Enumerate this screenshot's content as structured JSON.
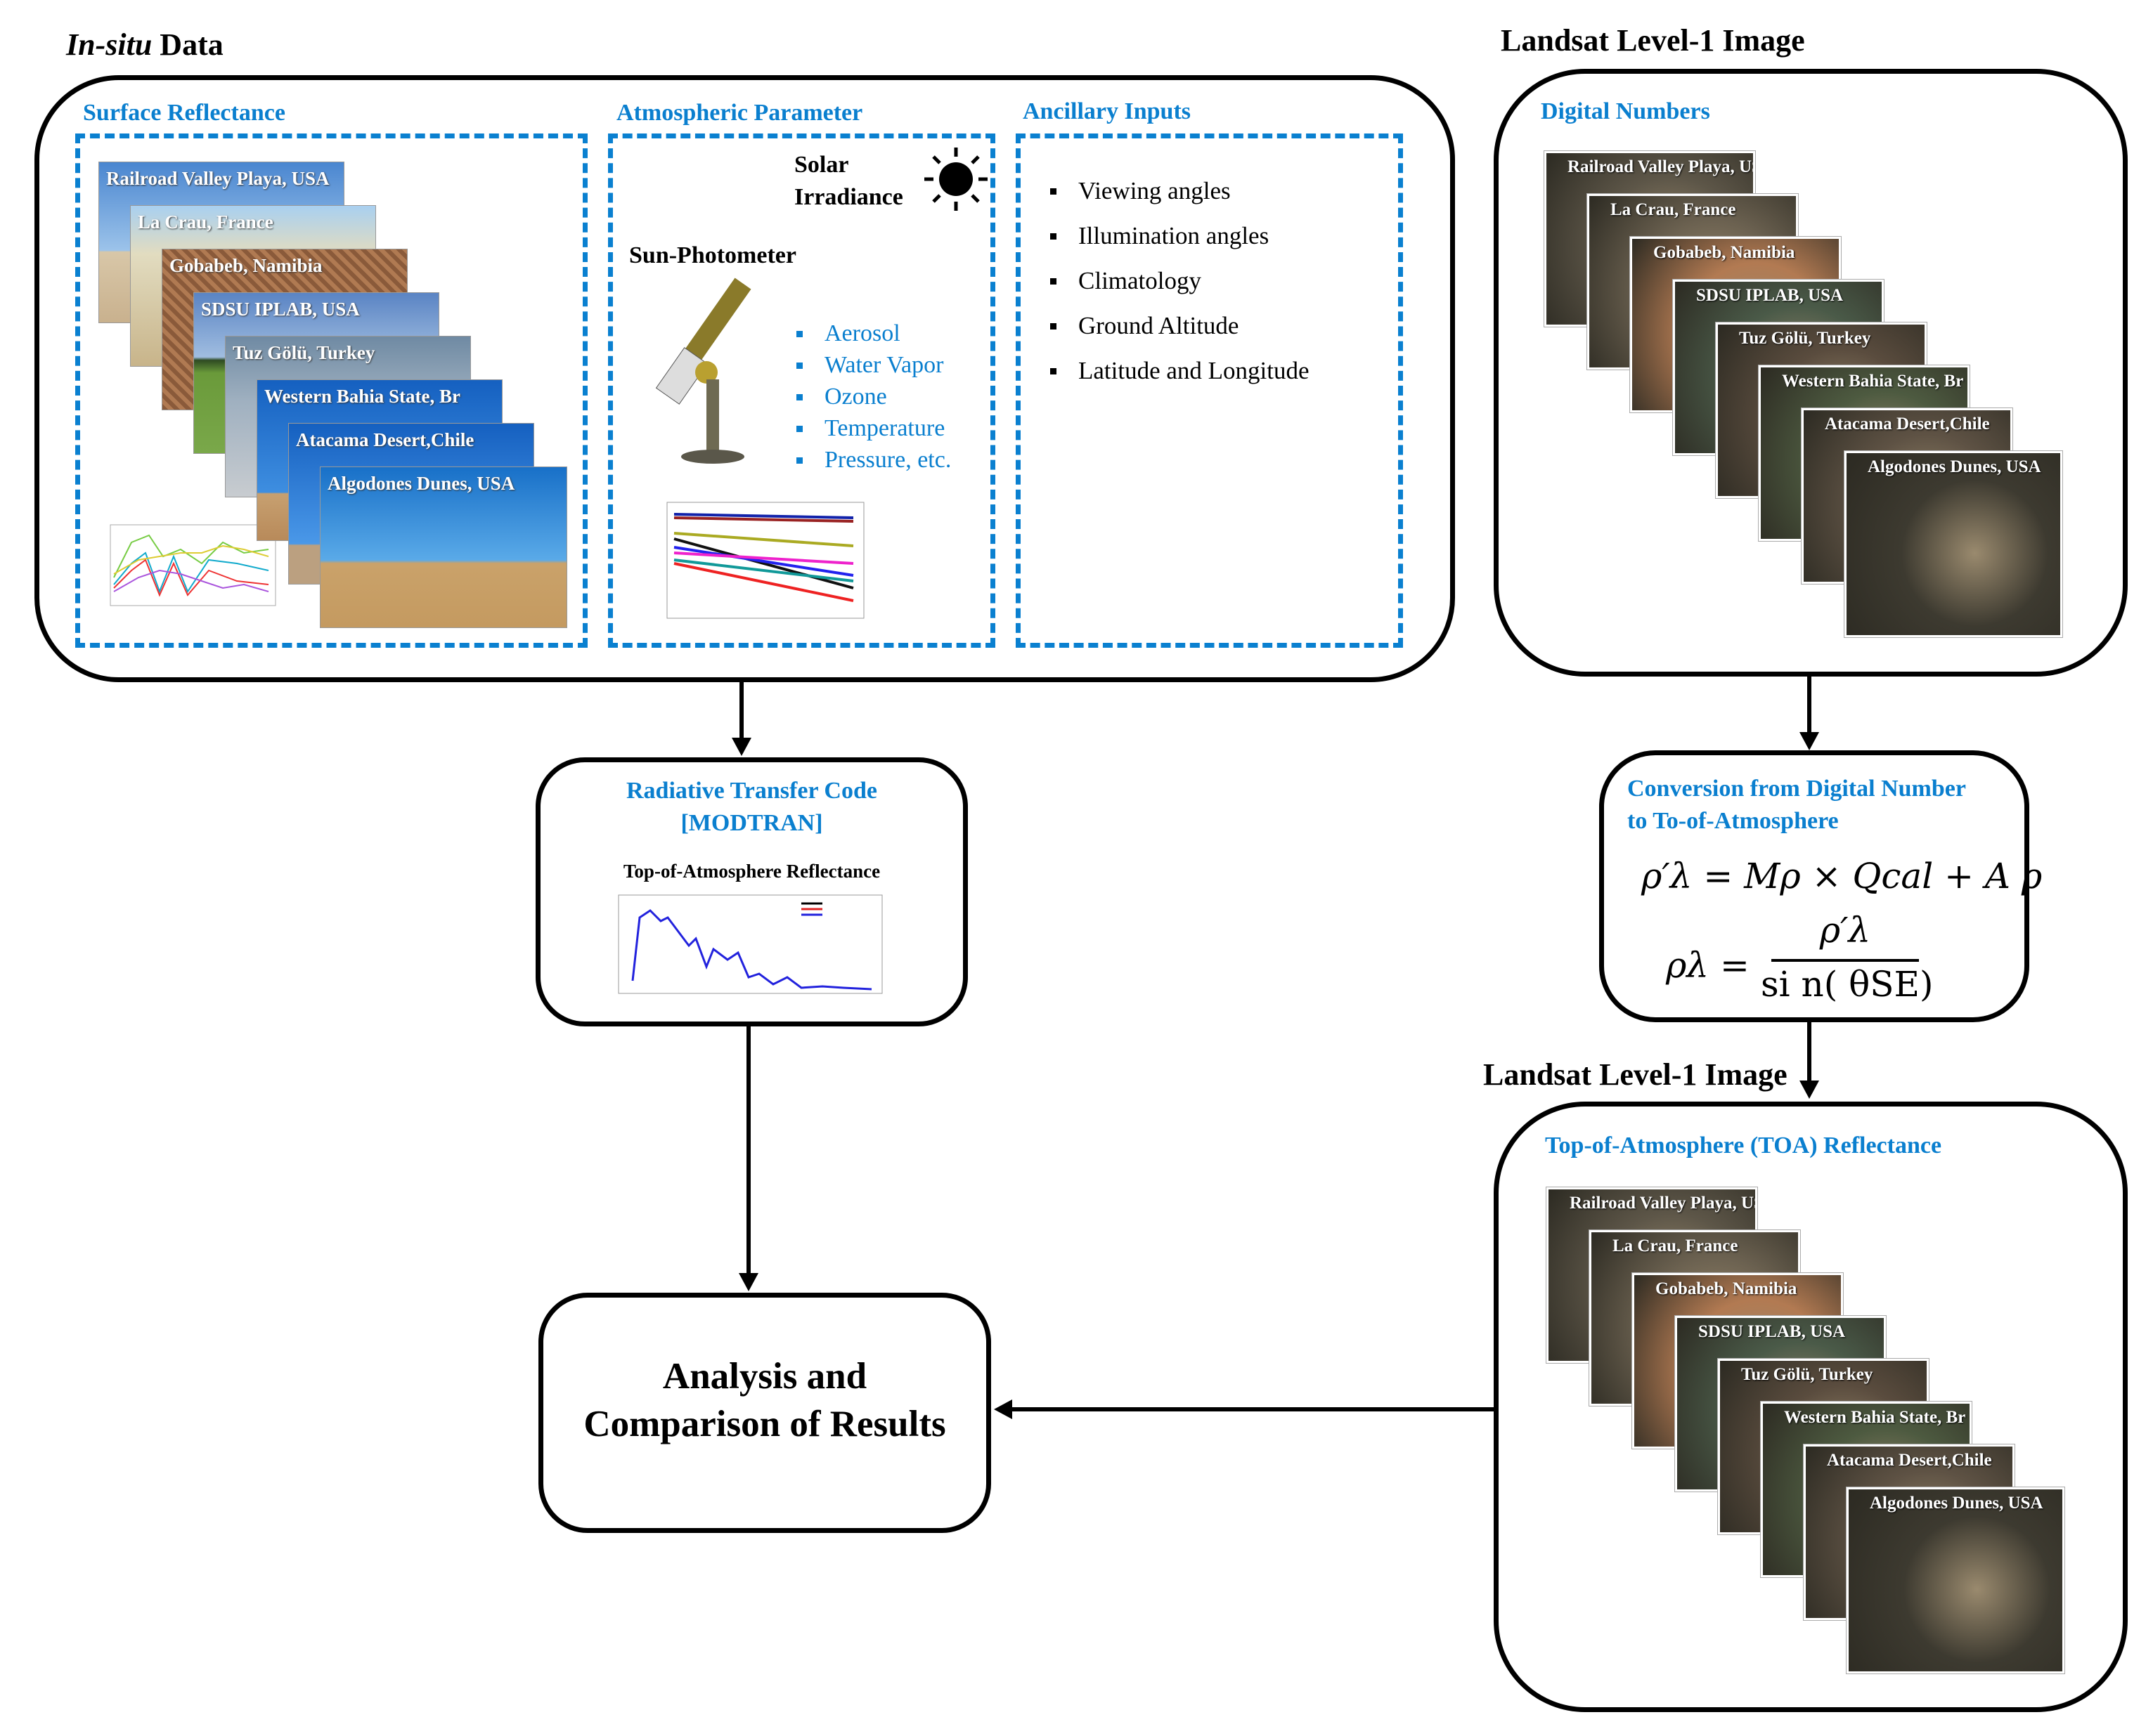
{
  "insitu": {
    "title_italic": "In-situ",
    "title_rest": " Data",
    "surface_reflectance": {
      "title": "Surface Reflectance",
      "sites": [
        "Railroad Valley Playa, USA",
        "La Crau, France",
        "Gobabeb, Namibia",
        "SDSU IPLAB, USA",
        "Tuz Gölü, Turkey",
        "Western Bahia State, Br",
        "Atacama Desert,Chile",
        "Algodones Dunes, USA"
      ]
    },
    "atmospheric_parameter": {
      "title": "Atmospheric Parameter",
      "solar_irradiance": "Solar Irradiance",
      "sun_photometer": "Sun-Photometer",
      "parameters": [
        "Aerosol",
        "Water Vapor",
        "Ozone",
        "Temperature",
        "Pressure, etc."
      ]
    },
    "ancillary_inputs": {
      "title": "Ancillary Inputs",
      "items": [
        "Viewing angles",
        "Illumination angles",
        "Climatology",
        "Ground Altitude",
        "Latitude and Longitude"
      ]
    }
  },
  "landsat_dn": {
    "title": "Landsat Level-1 Image",
    "subtitle": "Digital Numbers",
    "scenes": [
      "Railroad Valley Playa, USA",
      "La Crau, France",
      "Gobabeb, Namibia",
      "SDSU IPLAB, USA",
      "Tuz Gölü, Turkey",
      "Western Bahia State, Br",
      "Atacama Desert,Chile",
      "Algodones Dunes, USA"
    ]
  },
  "rtc": {
    "title_line1": "Radiative Transfer Code",
    "title_line2": "[MODTRAN]",
    "chart_title": "Top-of-Atmosphere Reflectance"
  },
  "conversion": {
    "title_line1": "Conversion from Digital Number",
    "title_line2": "to To-of-Atmosphere",
    "eq1": "ρ′λ = Mρ × Qcal + A ρ",
    "eq2_lhs": "ρλ =",
    "eq2_num": "ρ′λ",
    "eq2_den": "si n( θSE)"
  },
  "landsat_toa": {
    "title": "Landsat Level-1 Image",
    "subtitle": "Top-of-Atmosphere (TOA) Reflectance",
    "scenes": [
      "Railroad Valley Playa, USA",
      "La Crau, France",
      "Gobabeb, Namibia",
      "SDSU IPLAB, USA",
      "Tuz Gölü, Turkey",
      "Western Bahia State, Br",
      "Atacama Desert,Chile",
      "Algodones Dunes, USA"
    ]
  },
  "analysis": {
    "line1": "Analysis and",
    "line2": "Comparison of Results"
  },
  "colors": {
    "accent_blue": "#0a7fcf",
    "border": "#000000"
  }
}
